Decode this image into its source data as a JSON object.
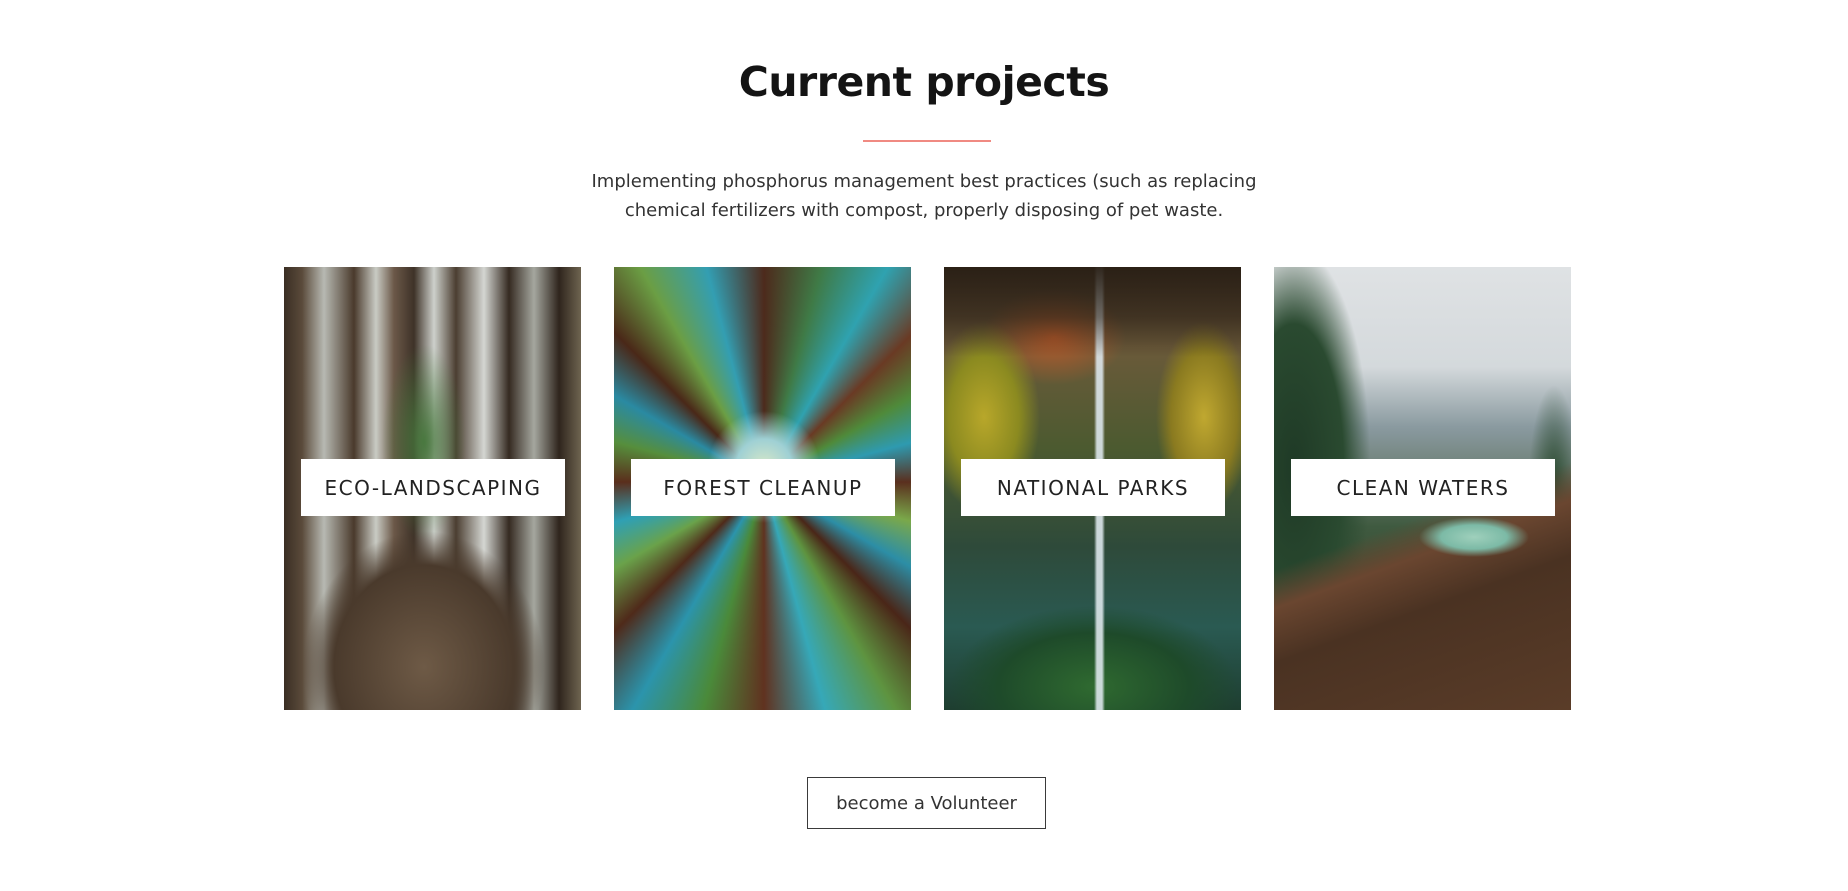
{
  "section": {
    "title": "Current projects",
    "description": "Implementing phosphorus management best practices (such as replacing chemical fertilizers with compost, properly disposing of pet waste.",
    "accent_color": "#f08a82"
  },
  "projects": [
    {
      "label": "ECO-LANDSCAPING",
      "image": "woman-holding-fern-in-forest"
    },
    {
      "label": "FOREST CLEANUP",
      "image": "redwood-trees-from-below"
    },
    {
      "label": "NATIONAL PARKS",
      "image": "waterfall-through-cave"
    },
    {
      "label": "CLEAN WATERS",
      "image": "mountain-lake-valley"
    }
  ],
  "cta": {
    "label": "become a Volunteer"
  }
}
